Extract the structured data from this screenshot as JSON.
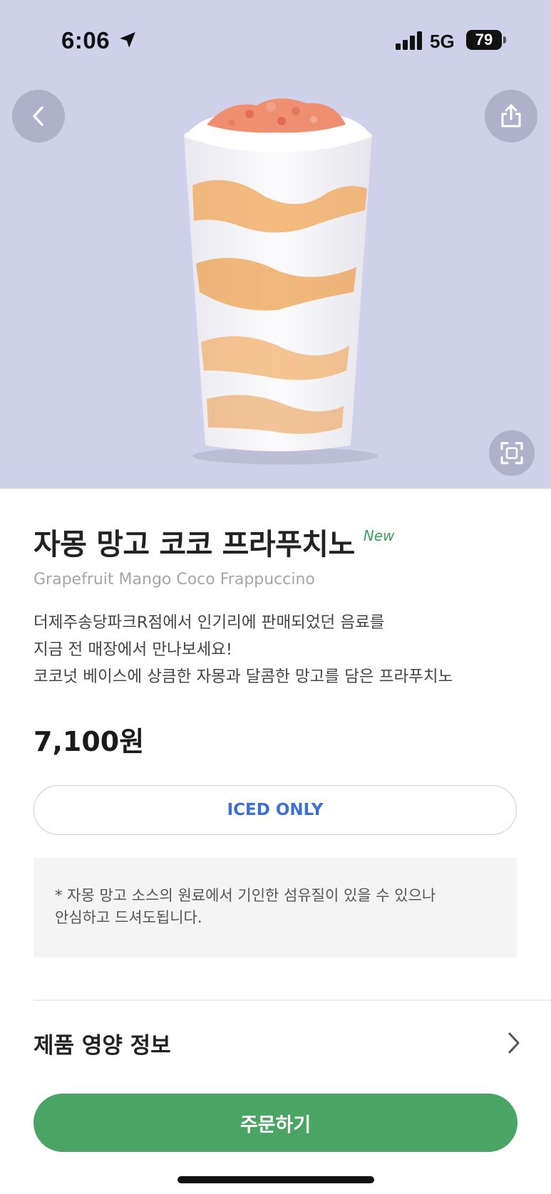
{
  "status_bar": {
    "time": "6:06",
    "network": "5G",
    "battery": "79"
  },
  "hero": {
    "background": "#cfd1ea",
    "icons": {
      "back": "chevron-left-icon",
      "share": "share-icon",
      "scan": "fullscreen-icon"
    }
  },
  "product": {
    "name_ko": "자몽 망고 코코 프라푸치노",
    "badge": "New",
    "name_en": "Grapefruit Mango Coco Frappuccino",
    "description_lines": [
      "더제주송당파크R점에서 인기리에 판매되었던 음료를",
      "지금 전 매장에서 만나보세요!",
      "코코넛 베이스에 상큼한 자몽과 달콤한 망고를 담은 프라푸치노"
    ],
    "price": "7,100원",
    "temperature_option": "ICED ONLY",
    "notice_lines": [
      "* 자몽 망고 소스의 원료에서 기인한 섬유질이 있을 수 있으나",
      "안심하고 드셔도됩니다."
    ]
  },
  "nutrition": {
    "label": "제품 영양 정보"
  },
  "order": {
    "label": "주문하기"
  },
  "colors": {
    "accent_green": "#4aa564",
    "iced_blue": "#3b6fd6",
    "new_green": "#3a9e5c"
  }
}
